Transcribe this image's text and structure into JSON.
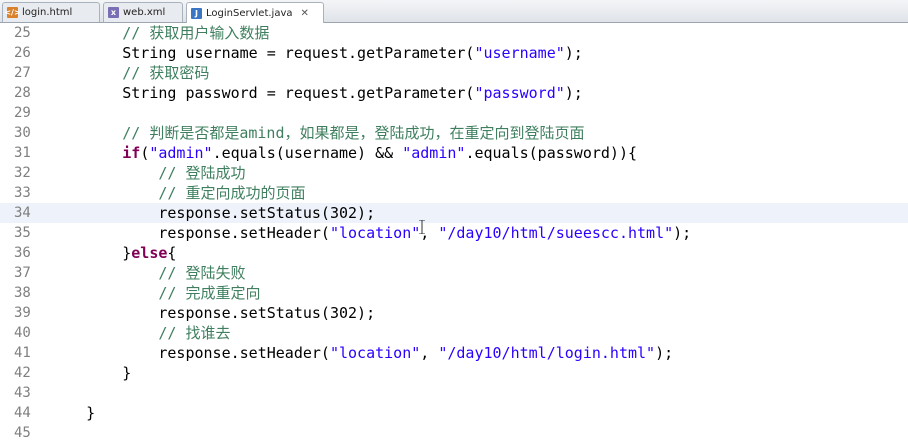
{
  "tabs": [
    {
      "label": "login.html",
      "icon": "html-file-icon"
    },
    {
      "label": "web.xml",
      "icon": "xml-file-icon"
    },
    {
      "label": "LoginServlet.java",
      "icon": "java-file-icon",
      "active": true
    }
  ],
  "lines": [
    {
      "n": "25",
      "t": [
        [
          "cm",
          "        // 获取用户输入数据"
        ]
      ]
    },
    {
      "n": "26",
      "t": [
        [
          "p",
          "        String username = request.getParameter("
        ],
        [
          "str",
          "\"username\""
        ],
        [
          "p",
          ");"
        ]
      ]
    },
    {
      "n": "27",
      "t": [
        [
          "cm",
          "        // 获取密码"
        ]
      ]
    },
    {
      "n": "28",
      "t": [
        [
          "p",
          "        String password = request.getParameter("
        ],
        [
          "str",
          "\"password\""
        ],
        [
          "p",
          ");"
        ]
      ]
    },
    {
      "n": "29",
      "t": []
    },
    {
      "n": "30",
      "t": [
        [
          "cm",
          "        // 判断是否都是amind，如果都是，登陆成功，在重定向到登陆页面"
        ]
      ]
    },
    {
      "n": "31",
      "t": [
        [
          "kw",
          "        if"
        ],
        [
          "p",
          "("
        ],
        [
          "str",
          "\"admin\""
        ],
        [
          "p",
          ".equals(username) && "
        ],
        [
          "str",
          "\"admin\""
        ],
        [
          "p",
          ".equals(password)){"
        ]
      ]
    },
    {
      "n": "32",
      "t": [
        [
          "cm",
          "            // 登陆成功"
        ]
      ]
    },
    {
      "n": "33",
      "t": [
        [
          "cm",
          "            // 重定向成功的页面"
        ]
      ]
    },
    {
      "n": "34",
      "t": [
        [
          "p",
          "            response.setStatus(302);"
        ]
      ],
      "current": true
    },
    {
      "n": "35",
      "t": [
        [
          "p",
          "            response.setHeader("
        ],
        [
          "str",
          "\"location\""
        ],
        [
          "p",
          ", "
        ],
        [
          "str",
          "\"/day10/html/sueescc.html\""
        ],
        [
          "p",
          ");"
        ]
      ]
    },
    {
      "n": "36",
      "t": [
        [
          "p",
          "        }"
        ],
        [
          "kw",
          "else"
        ],
        [
          "p",
          "{"
        ]
      ]
    },
    {
      "n": "37",
      "t": [
        [
          "cm",
          "            // 登陆失败"
        ]
      ]
    },
    {
      "n": "38",
      "t": [
        [
          "cm",
          "            // 完成重定向"
        ]
      ]
    },
    {
      "n": "39",
      "t": [
        [
          "p",
          "            response.setStatus(302);"
        ]
      ]
    },
    {
      "n": "40",
      "t": [
        [
          "cm",
          "            // 找谁去"
        ]
      ]
    },
    {
      "n": "41",
      "t": [
        [
          "p",
          "            response.setHeader("
        ],
        [
          "str",
          "\"location\""
        ],
        [
          "p",
          ", "
        ],
        [
          "str",
          "\"/day10/html/login.html\""
        ],
        [
          "p",
          ");"
        ]
      ]
    },
    {
      "n": "42",
      "t": [
        [
          "p",
          "        }"
        ]
      ]
    },
    {
      "n": "43",
      "t": []
    },
    {
      "n": "44",
      "t": [
        [
          "p",
          "    }"
        ]
      ]
    },
    {
      "n": "45",
      "t": []
    }
  ]
}
